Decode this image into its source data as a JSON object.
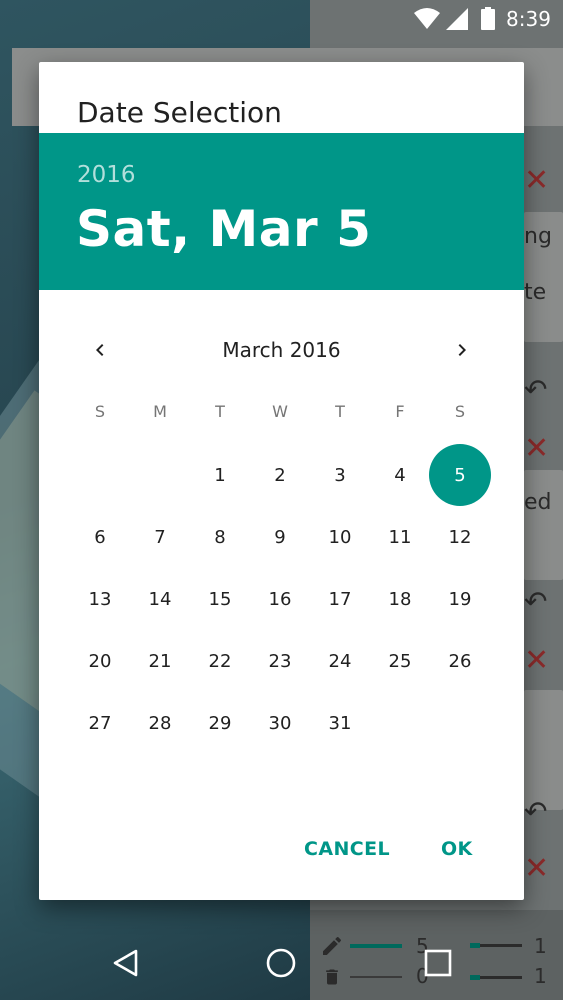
{
  "status_bar": {
    "time": "8:39"
  },
  "dialog": {
    "title": "Date Selection",
    "header": {
      "year": "2016",
      "date": "Sat, Mar 5"
    },
    "calendar": {
      "month_label": "March 2016",
      "weekdays": [
        "S",
        "M",
        "T",
        "W",
        "T",
        "F",
        "S"
      ],
      "weeks": [
        [
          "",
          "",
          "1",
          "2",
          "3",
          "4",
          "5"
        ],
        [
          "6",
          "7",
          "8",
          "9",
          "10",
          "11",
          "12"
        ],
        [
          "13",
          "14",
          "15",
          "16",
          "17",
          "18",
          "19"
        ],
        [
          "20",
          "21",
          "22",
          "23",
          "24",
          "25",
          "26"
        ],
        [
          "27",
          "28",
          "29",
          "30",
          "31",
          "",
          ""
        ]
      ],
      "selected_day": "5"
    },
    "buttons": {
      "cancel": "CANCEL",
      "ok": "OK"
    }
  },
  "background": {
    "text_fragments": [
      "ng",
      "te",
      "ed"
    ],
    "counts": [
      "5",
      "0",
      "1",
      "1"
    ]
  },
  "colors": {
    "accent": "#009688",
    "header_year": "#b2dfdb"
  }
}
